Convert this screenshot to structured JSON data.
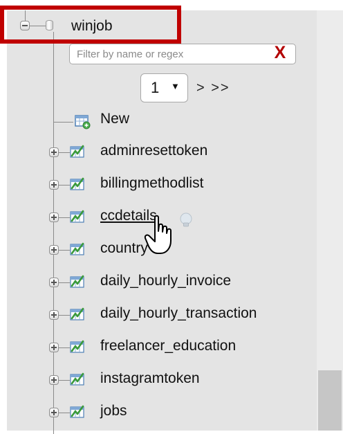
{
  "tree": {
    "database": {
      "name": "winjob",
      "expanded": true
    },
    "filter": {
      "placeholder": "Filter by name or regex",
      "value": "",
      "clear_label": "X"
    },
    "pagination": {
      "selected_page": "1",
      "nav_label": "> >>"
    },
    "new_label": "New",
    "tables": [
      {
        "name": "adminresettoken"
      },
      {
        "name": "billingmethodlist"
      },
      {
        "name": "ccdetails",
        "hovered": true
      },
      {
        "name": "country"
      },
      {
        "name": "daily_hourly_invoice"
      },
      {
        "name": "daily_hourly_transaction"
      },
      {
        "name": "freelancer_education"
      },
      {
        "name": "instagramtoken"
      },
      {
        "name": "jobs"
      }
    ]
  },
  "colors": {
    "panel_bg": "#e4e4e4",
    "highlight": "#c00000",
    "clear_x": "#b30000",
    "scrollbar_thumb": "#c6c6c6"
  },
  "icons": [
    "collapse-icon",
    "database-icon",
    "new-table-icon",
    "table-icon",
    "expand-icon",
    "hint-bulb-icon",
    "hand-cursor-icon"
  ]
}
